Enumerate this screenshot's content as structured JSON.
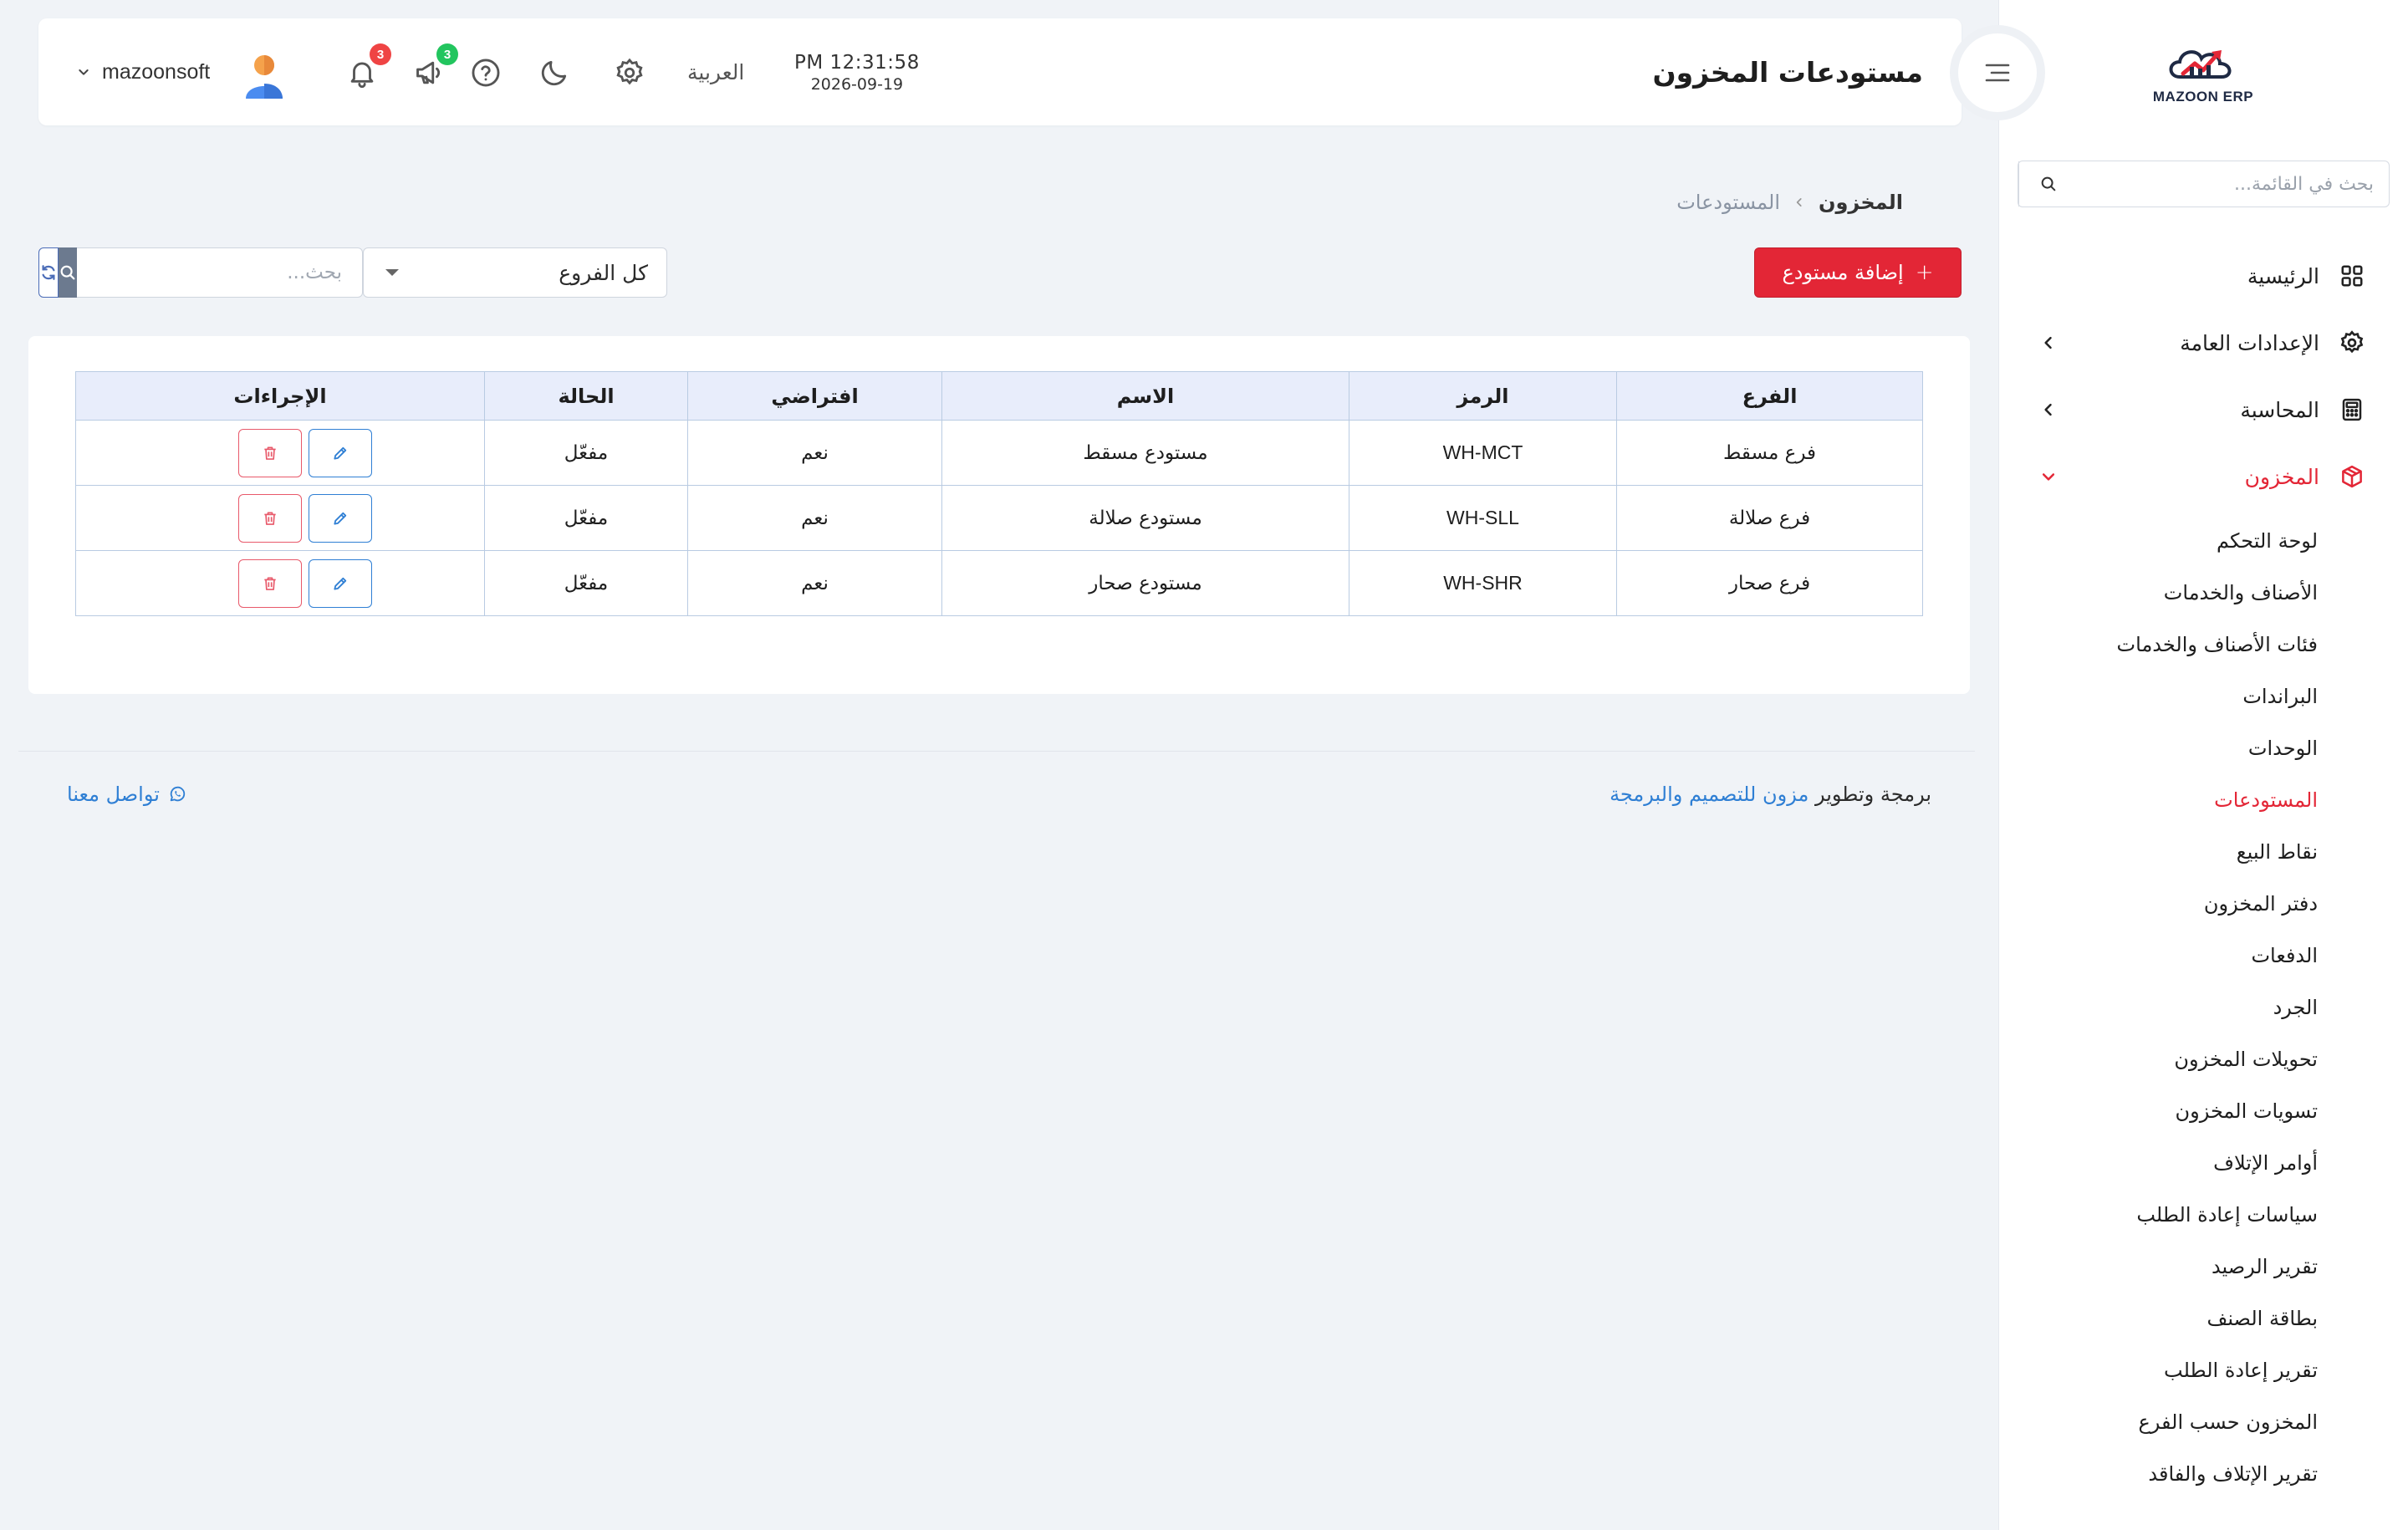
{
  "app": {
    "logo_text": "MAZOON ERP"
  },
  "header": {
    "title": "مستودعات المخزون",
    "time": "PM 12:31:58",
    "date": "2026-09-19",
    "language": "العربية",
    "announcements_count": "3",
    "notifications_count": "3",
    "username": "mazoonsoft"
  },
  "sidebar": {
    "search_placeholder": "بحث في القائمة...",
    "items": [
      {
        "label": "الرئيسية",
        "icon": "grid-icon"
      },
      {
        "label": "الإعدادات العامة",
        "icon": "gear-icon"
      },
      {
        "label": "المحاسبة",
        "icon": "calculator-icon"
      },
      {
        "label": "المخزون",
        "icon": "box-icon"
      }
    ],
    "inventory_sub": [
      "لوحة التحكم",
      "الأصناف والخدمات",
      "فئات الأصناف والخدمات",
      "البراندات",
      "الوحدات",
      "المستودعات",
      "نقاط البيع",
      "دفتر المخزون",
      "الدفعات",
      "الجرد",
      "تحويلات المخزون",
      "تسويات المخزون",
      "أوامر الإتلاف",
      "سياسات إعادة الطلب",
      "تقرير الرصيد",
      "بطاقة الصنف",
      "تقرير إعادة الطلب",
      "المخزون حسب الفرع",
      "تقرير الإتلاف والفاقد"
    ]
  },
  "breadcrumb": {
    "root": "المخزون",
    "current": "المستودعات"
  },
  "toolbar": {
    "add_label": "إضافة مستودع",
    "branch_filter": "كل الفروع",
    "search_placeholder": "بحث..."
  },
  "table": {
    "headers": {
      "branch": "الفرع",
      "code": "الرمز",
      "name": "الاسم",
      "default": "افتراضي",
      "status": "الحالة",
      "actions": "الإجراءات"
    },
    "rows": [
      {
        "branch": "فرع مسقط",
        "code": "WH-MCT",
        "name": "مستودع مسقط",
        "default": "نعم",
        "status": "مفعّل"
      },
      {
        "branch": "فرع صلالة",
        "code": "WH-SLL",
        "name": "مستودع صلالة",
        "default": "نعم",
        "status": "مفعّل"
      },
      {
        "branch": "فرع صحار",
        "code": "WH-SHR",
        "name": "مستودع صحار",
        "default": "نعم",
        "status": "مفعّل"
      }
    ]
  },
  "footer": {
    "credit_prefix": "برمجة وتطوير",
    "credit_brand": "مزون للتصميم والبرمجة",
    "contact": "تواصل معنا"
  },
  "colors": {
    "accent": "#e32636",
    "link": "#2f7fd4",
    "badge_red": "#ef4444",
    "badge_green": "#22c55e"
  }
}
